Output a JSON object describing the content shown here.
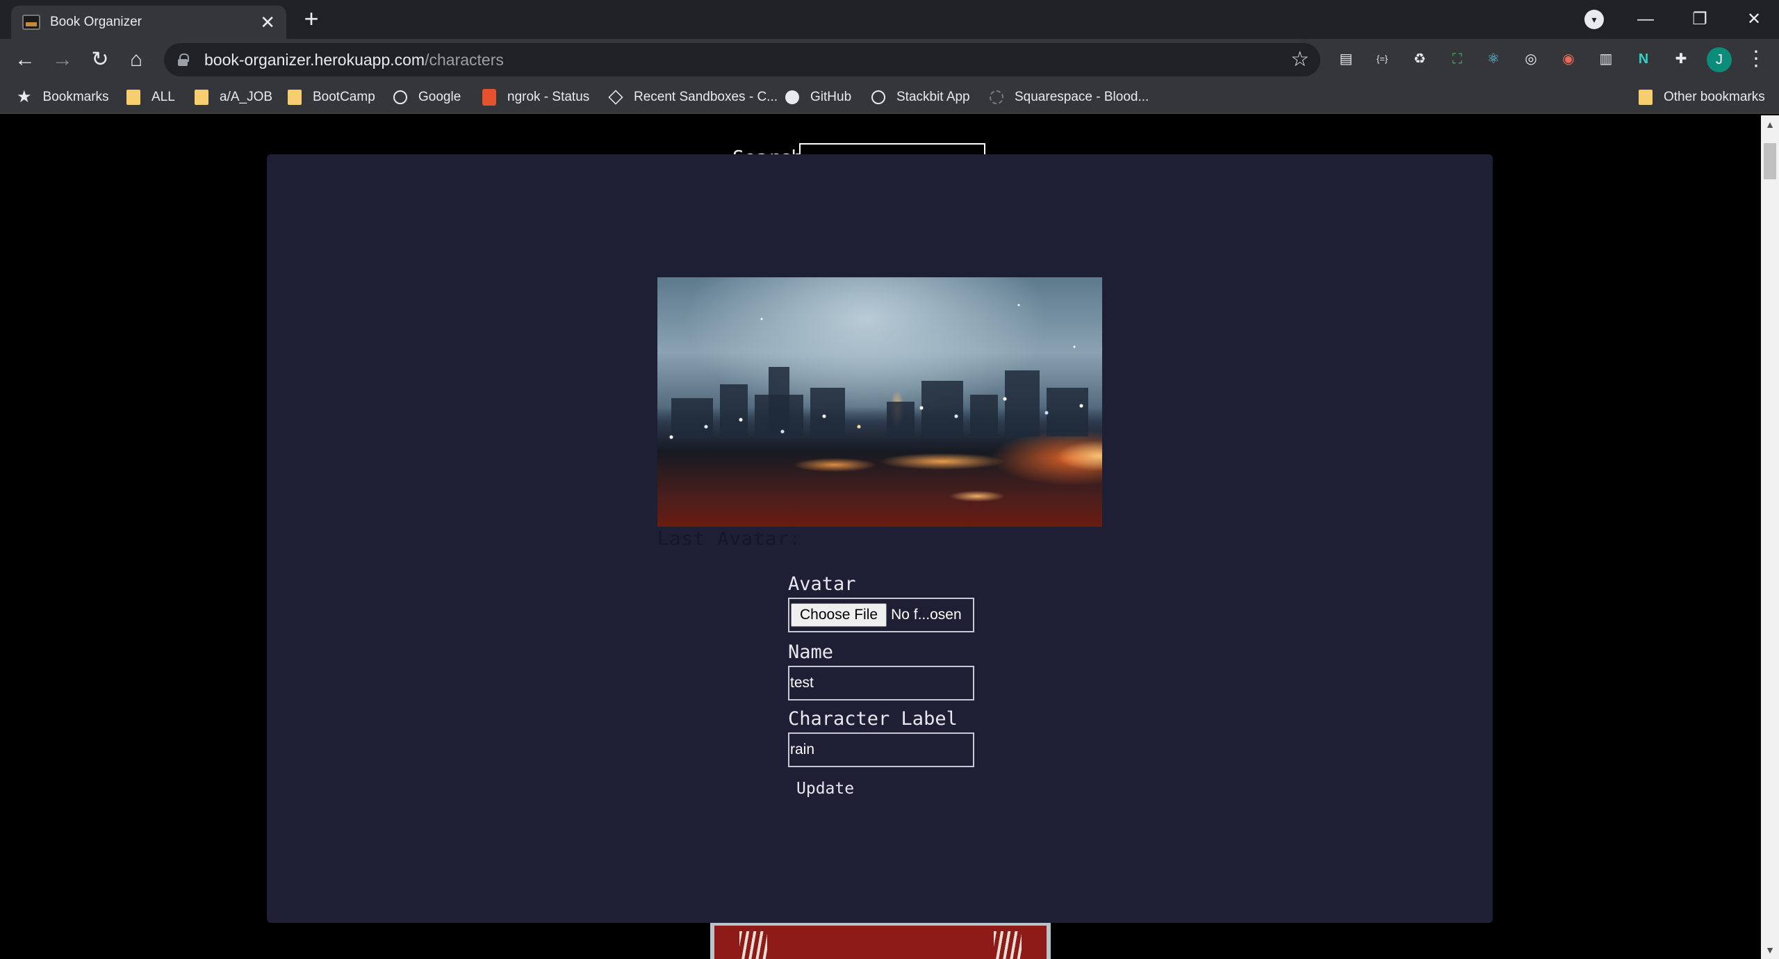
{
  "browser": {
    "tab_title": "Book Organizer",
    "url_host": "book-organizer.herokuapp.com",
    "url_path": "/characters",
    "profile_initial": "J",
    "bookmarks": [
      {
        "label": "Bookmarks",
        "icon": "star-icon"
      },
      {
        "label": "ALL",
        "icon": "folder-icon"
      },
      {
        "label": "a/A_JOB",
        "icon": "folder-icon"
      },
      {
        "label": "BootCamp",
        "icon": "folder-icon"
      },
      {
        "label": "Google",
        "icon": "globe-icon"
      },
      {
        "label": "ngrok - Status",
        "icon": "ngrok-icon"
      },
      {
        "label": "Recent Sandboxes - C...",
        "icon": "codesandbox-icon"
      },
      {
        "label": "GitHub",
        "icon": "github-icon"
      },
      {
        "label": "Stackbit App",
        "icon": "globe-icon"
      },
      {
        "label": "Squarespace - Blood...",
        "icon": "squarespace-icon"
      }
    ],
    "other_bookmarks": "Other bookmarks"
  },
  "page": {
    "search_label": "Search:",
    "modal": {
      "last_avatar_label": "Last Avatar:",
      "avatar_label": "Avatar",
      "file_button": "Choose File",
      "file_name": "No f...osen",
      "name_label": "Name",
      "name_value": "test",
      "character_label_label": "Character Label",
      "character_label_value": "rain",
      "update_button": "Update"
    }
  },
  "colors": {
    "modal_bg": "#1e1f34",
    "page_bg": "#000000",
    "chrome_bg": "#35363a"
  }
}
